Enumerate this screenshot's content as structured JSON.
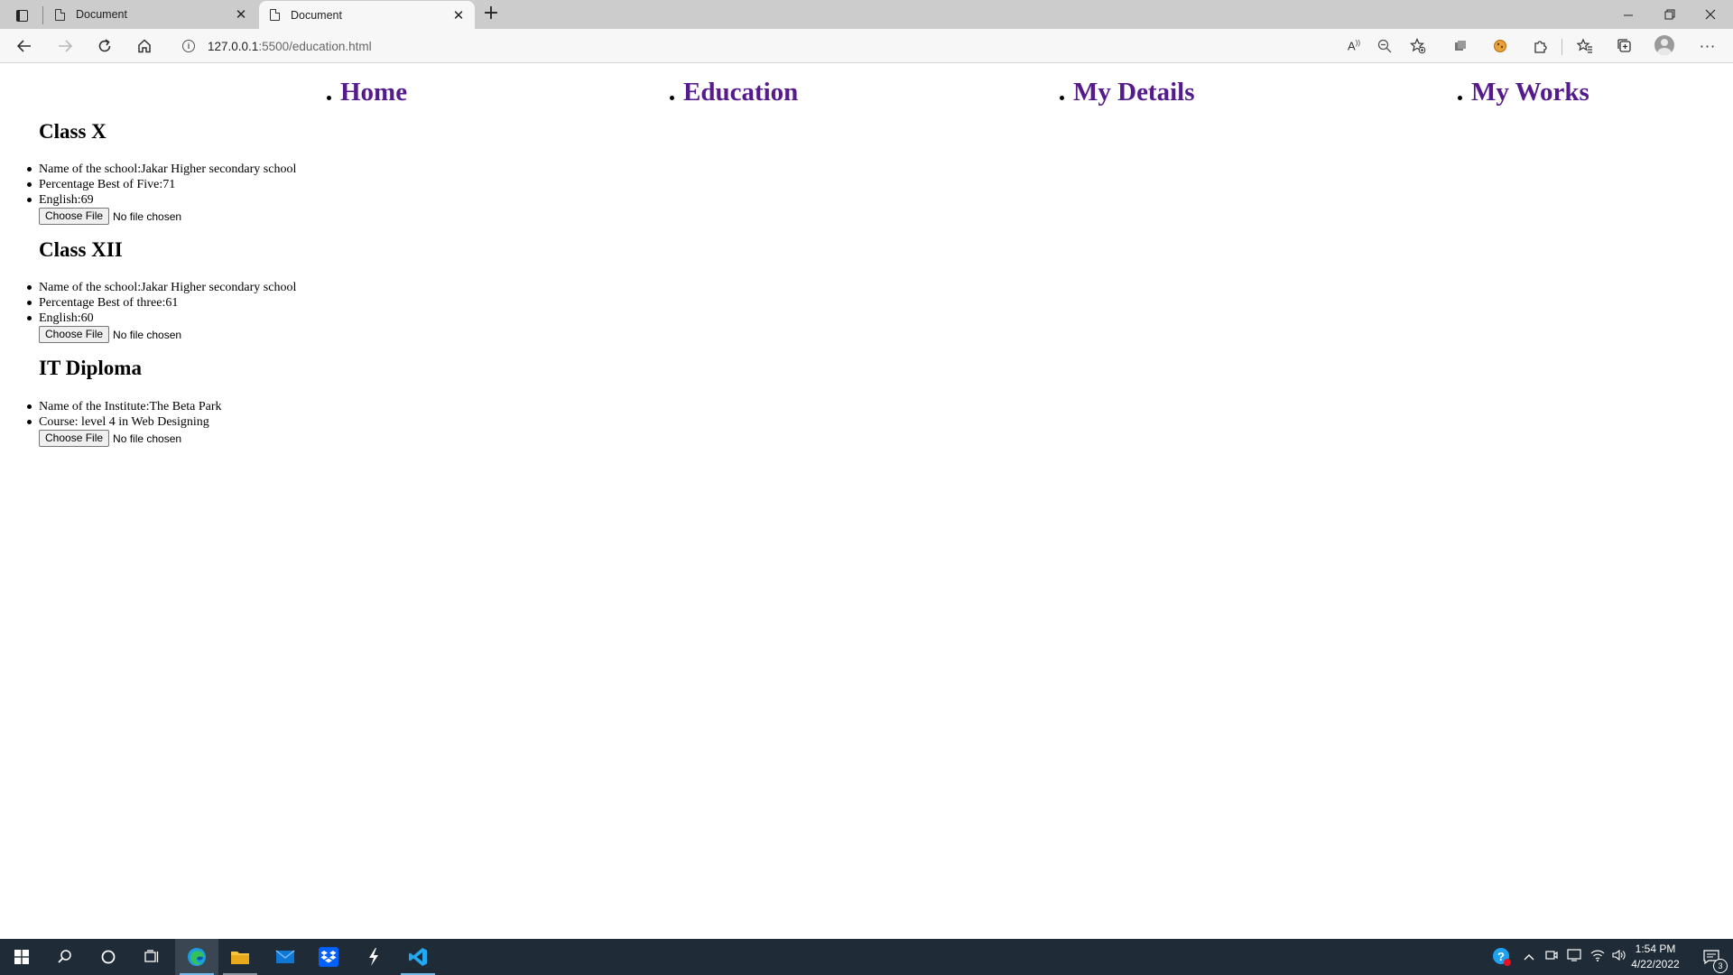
{
  "browser": {
    "tabs": [
      {
        "title": "Document",
        "active": false
      },
      {
        "title": "Document",
        "active": true
      }
    ],
    "url_host": "127.0.0.1",
    "url_path": ":5500/education.html"
  },
  "nav": {
    "items": [
      {
        "label": "Home"
      },
      {
        "label": "Education"
      },
      {
        "label": "My Details"
      },
      {
        "label": "My Works"
      }
    ]
  },
  "sections": [
    {
      "heading": "Class X",
      "items": [
        "Name of the school:Jakar Higher secondary school",
        "Percentage Best of Five:71",
        "English:69"
      ],
      "file_button": "Choose File",
      "file_status": "No file chosen"
    },
    {
      "heading": "Class XII",
      "items": [
        "Name of the school:Jakar Higher secondary school",
        "Percentage Best of three:61",
        "English:60"
      ],
      "file_button": "Choose File",
      "file_status": "No file chosen"
    },
    {
      "heading": "IT Diploma",
      "items": [
        "Name of the Institute:The Beta Park",
        "Course: level 4 in Web Designing"
      ],
      "file_button": "Choose File",
      "file_status": "No file chosen"
    }
  ],
  "taskbar": {
    "time": "1:54 PM",
    "date": "4/22/2022",
    "notification_count": "3"
  },
  "colors": {
    "nav_link": "#551a8b",
    "taskbar_bg": "#1f2b36",
    "tabstrip_bg": "#cccccc"
  }
}
